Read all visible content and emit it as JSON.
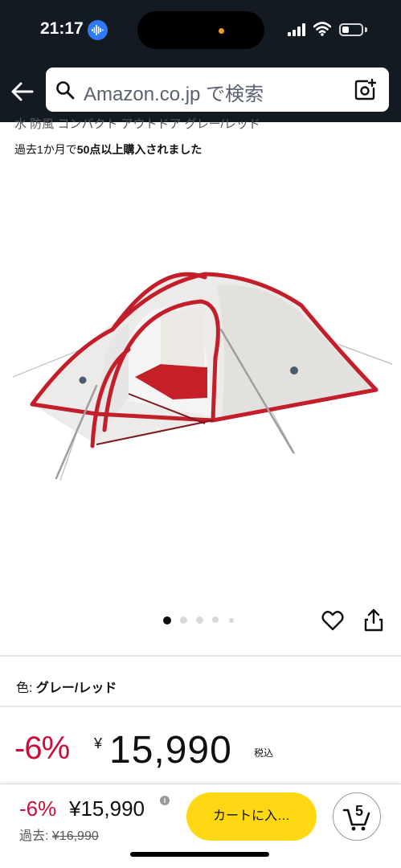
{
  "status_bar": {
    "time": "21:17"
  },
  "search": {
    "placeholder": "Amazon.co.jp で検索"
  },
  "product": {
    "title_partial": "水 防風 コンパクト アウトドア グレー/レッド",
    "purchase_prefix": "過去1か月で",
    "purchase_bold": "50点以上購入されました",
    "image_alt": "tent",
    "carousel": {
      "total_dots": 5,
      "active_index": 0
    },
    "color_label": "色:",
    "color_value": "グレー/レッド",
    "discount": "-6%",
    "currency": "¥",
    "price": "15,990",
    "tax_note": "税込"
  },
  "bottom_bar": {
    "discount": "-6%",
    "price": "¥15,990",
    "info": "i",
    "past_label": "過去:",
    "past_price": "¥16,990",
    "cart_button_label": "カートに入…",
    "cart_count": "5"
  },
  "colors": {
    "header_bg": "#131a22",
    "discount_red": "#cc0c39",
    "cart_button_yellow": "#ffd814",
    "siri_blue": "#2f7bf6"
  },
  "icons": [
    "waveform-icon",
    "signal-icon",
    "wifi-icon",
    "battery-icon",
    "back-arrow-icon",
    "search-icon",
    "camera-search-icon",
    "heart-icon",
    "share-icon",
    "info-icon",
    "cart-icon"
  ]
}
